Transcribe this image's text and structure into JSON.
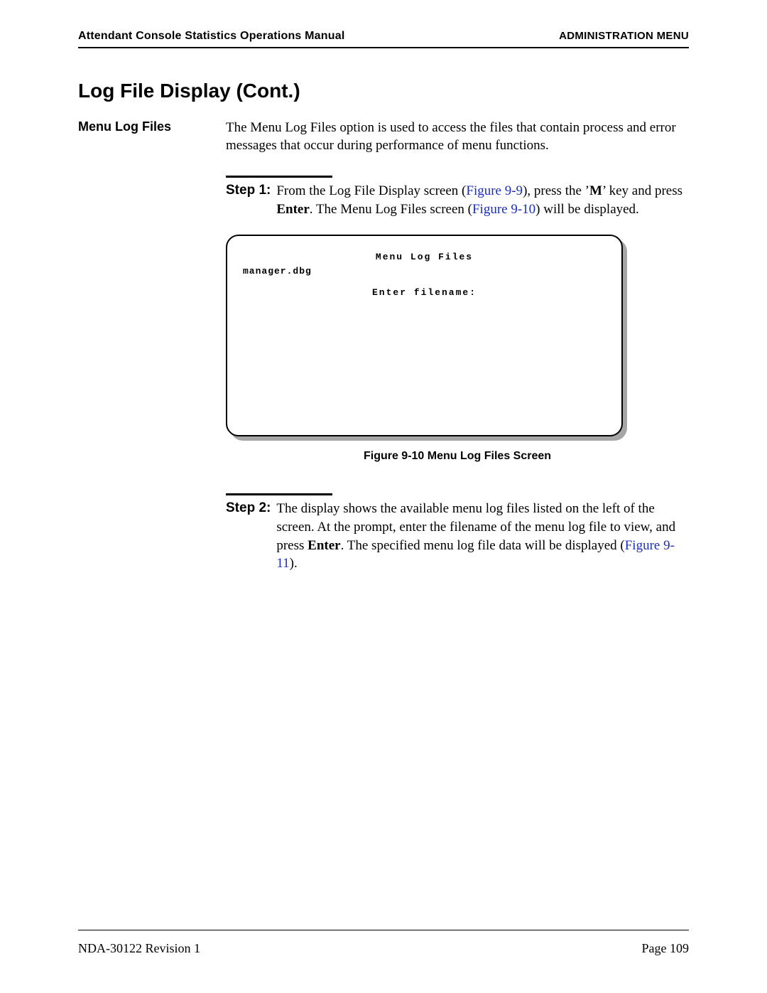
{
  "header": {
    "left_title": "Attendant Console Statistics Operations Manual",
    "right_title": "ADMINISTRATION MENU"
  },
  "section_title": "Log File Display (Cont.)",
  "side_heading": "Menu Log Files",
  "intro_text": "The Menu Log Files option is used to access the files that contain process and error messages that occur during performance of menu functions.",
  "step1": {
    "label": "Step 1:",
    "seg1": "From the Log File Display screen (",
    "ref1": "Figure 9-9",
    "seg2": "), press the ’",
    "key1": "M",
    "seg3": "’ key and press ",
    "key2": "Enter",
    "seg4": ". The Menu Log Files screen (",
    "ref2": "Figure 9-10",
    "seg5": ") will be displayed."
  },
  "terminal": {
    "title": "Menu Log Files",
    "listed_file": "manager.dbg",
    "prompt": "Enter filename:"
  },
  "figure_caption": "Figure 9-10   Menu Log Files Screen",
  "step2": {
    "label": "Step 2:",
    "seg1": "The display shows the available menu log files listed on the left of the screen. At the prompt, enter the filename of the menu log file to view, and press ",
    "key1": "Enter",
    "seg2": ". The specified menu log file data will be displayed (",
    "ref1": "Figure 9-11",
    "seg3": ")."
  },
  "footer": {
    "doc_id": "NDA-30122   Revision 1",
    "page": "Page 109"
  }
}
